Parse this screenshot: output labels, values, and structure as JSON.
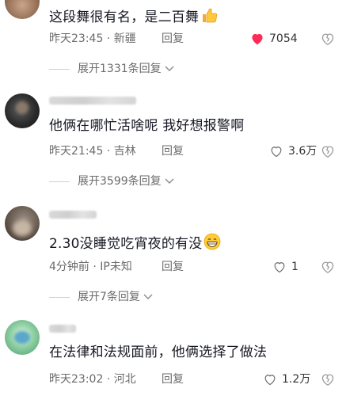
{
  "comments": [
    {
      "text": "这段舞很有名，是二百舞",
      "emoji": "thumbs-up-emoji",
      "time": "昨天23:45",
      "location": "新疆",
      "reply_label": "回复",
      "likes": "7054",
      "liked": true,
      "expand_label": "展开1331条回复"
    },
    {
      "text": "他俩在哪忙活啥呢  我好想报警啊",
      "time": "昨天21:45",
      "location": "吉林",
      "reply_label": "回复",
      "likes": "3.6万",
      "liked": false,
      "expand_label": "展开3599条回复"
    },
    {
      "text": "2.30没睡觉吃宵夜的有没",
      "emoji": "grinning-face-emoji",
      "time": "4分钟前",
      "location": "IP未知",
      "reply_label": "回复",
      "likes": "1",
      "liked": false,
      "expand_label": "展开7条回复"
    },
    {
      "text": "在法律和法规面前，他俩选择了做法",
      "time": "昨天23:02",
      "location": "河北",
      "reply_label": "回复",
      "likes": "1.2万",
      "liked": false
    }
  ],
  "separator": " · ",
  "colors": {
    "text": "#161823",
    "meta": "#6b6b6b",
    "like_active": "#fe2c55"
  }
}
